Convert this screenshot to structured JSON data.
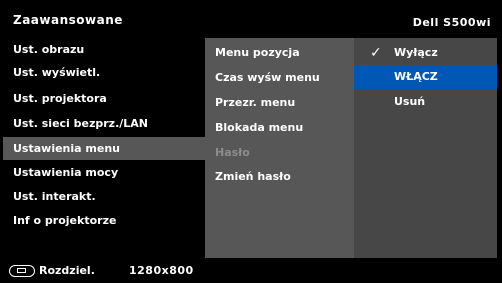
{
  "header": {
    "title": "Zaawansowane",
    "model": "Dell S500wi"
  },
  "main_menu": [
    {
      "label": "Ust. obrazu"
    },
    {
      "label": "Ust. wyświetl."
    },
    {
      "label": "Ust. projektora"
    },
    {
      "label": "Ust. sieci bezprz./LAN"
    },
    {
      "label": "Ustawienia menu",
      "selected": true
    },
    {
      "label": "Ustawienia mocy"
    },
    {
      "label": "Ust. interakt."
    },
    {
      "label": "Inf o projektorze"
    }
  ],
  "sub_menu": [
    {
      "label": "Menu pozycja"
    },
    {
      "label": "Czas wyśw menu"
    },
    {
      "label": "Przezr. menu"
    },
    {
      "label": "Blokada menu"
    },
    {
      "label": "Hasło",
      "disabled": true
    },
    {
      "label": "Zmień hasło"
    }
  ],
  "options": [
    {
      "label": "Wyłącz",
      "checked": true
    },
    {
      "label": "WŁĄCZ",
      "highlighted": true
    },
    {
      "label": "Usuń"
    }
  ],
  "status": {
    "icon": "video-source-icon",
    "resolution_label": "Rozdziel.",
    "resolution_value": "1280x800"
  },
  "colors": {
    "selected_bg": "#575757",
    "highlight_bg": "#0058b4",
    "options_bg": "#474747",
    "disabled_text": "#8c8c8c"
  }
}
